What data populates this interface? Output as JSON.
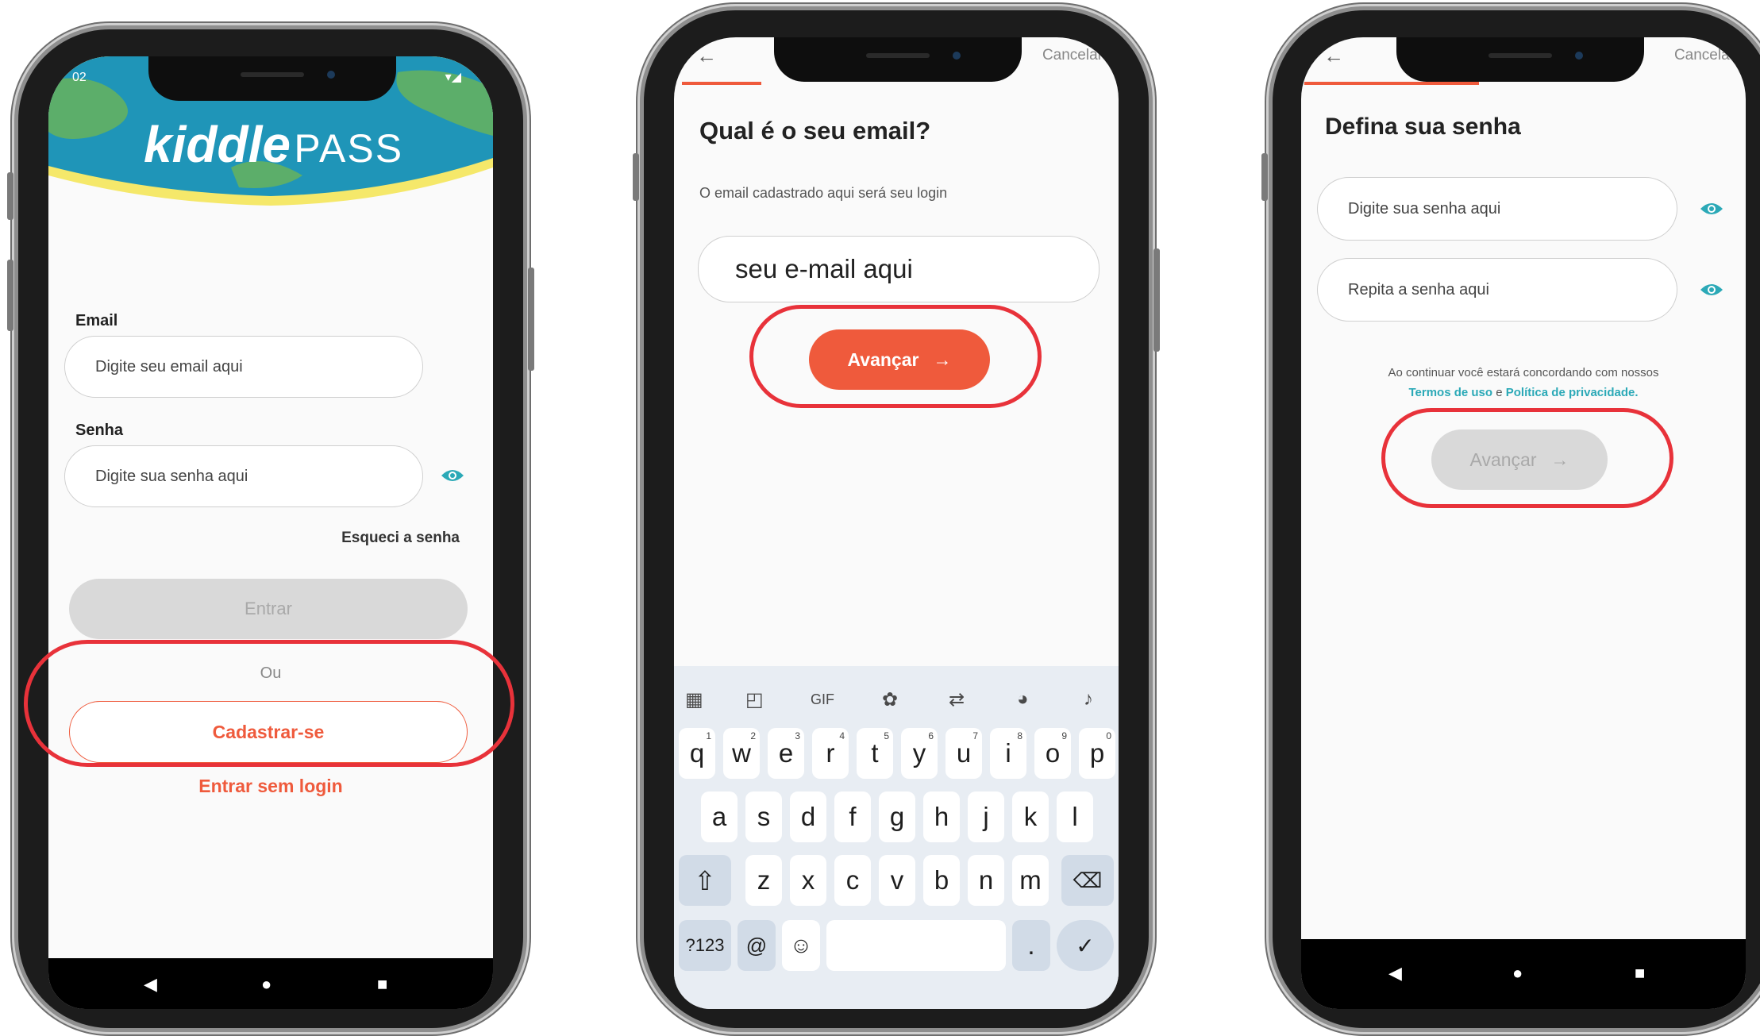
{
  "screen1": {
    "status_time": "02",
    "logo_main": "kiddle",
    "logo_accent": "PASS",
    "email_label": "Email",
    "email_placeholder": "Digite seu email aqui",
    "password_label": "Senha",
    "password_placeholder": "Digite sua senha aqui",
    "forgot_password": "Esqueci a senha",
    "login_button": "Entrar",
    "or_text": "Ou",
    "signup_button": "Cadastrar-se",
    "guest_link": "Entrar sem login"
  },
  "screen2": {
    "cancel_label": "Cancelar",
    "title": "Qual é o seu email?",
    "subtitle": "O email cadastrado aqui será seu login",
    "email_value": "seu e-mail aqui",
    "next_button": "Avançar",
    "keyboard": {
      "row1": [
        [
          "q",
          "1"
        ],
        [
          "w",
          "2"
        ],
        [
          "e",
          "3"
        ],
        [
          "r",
          "4"
        ],
        [
          "t",
          "5"
        ],
        [
          "y",
          "6"
        ],
        [
          "u",
          "7"
        ],
        [
          "i",
          "8"
        ],
        [
          "o",
          "9"
        ],
        [
          "p",
          "0"
        ]
      ],
      "row2": [
        "a",
        "s",
        "d",
        "f",
        "g",
        "h",
        "j",
        "k",
        "l"
      ],
      "row3": [
        "z",
        "x",
        "c",
        "v",
        "b",
        "n",
        "m"
      ],
      "symbols_key": "?123",
      "at_key": "@",
      "period_key": ".",
      "gif_label": "GIF"
    }
  },
  "screen3": {
    "cancel_label": "Cancelar",
    "title": "Defina sua senha",
    "password_placeholder": "Digite sua senha aqui",
    "repeat_placeholder": "Repita a senha aqui",
    "terms_prefix": "Ao continuar você estará concordando com nossos",
    "terms_link": "Termos de uso",
    "terms_and": "e",
    "privacy_link": "Política de privacidade.",
    "next_button": "Avançar"
  },
  "colors": {
    "accent": "#ef5a3c",
    "teal": "#2ba9b7",
    "disabled_button": "#d9d9d9",
    "highlight_ring": "#e8323a",
    "logo_blue": "#1f95b8",
    "logo_green": "#5cae6a"
  },
  "icons": [
    "back-arrow-icon",
    "eye-icon",
    "arrow-right-icon",
    "apps-grid-icon",
    "sticker-icon",
    "gear-icon",
    "translate-icon",
    "palette-icon",
    "mic-icon",
    "shift-icon",
    "backspace-icon",
    "emoji-icon",
    "check-icon",
    "nav-back-icon",
    "nav-home-icon",
    "nav-recents-icon"
  ]
}
